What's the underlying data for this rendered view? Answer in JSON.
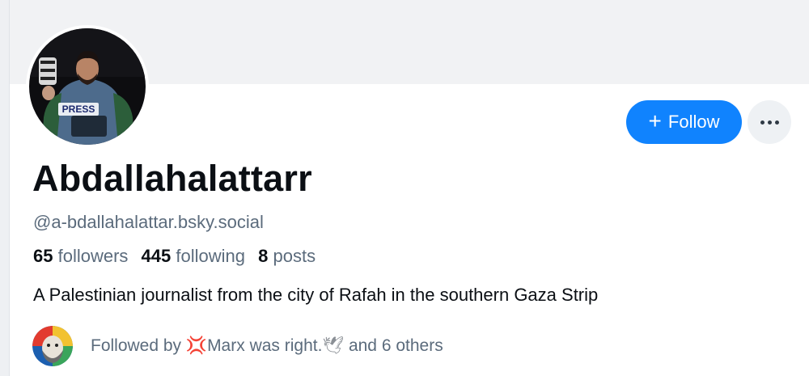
{
  "profile": {
    "display_name": "Abdallahalattarr",
    "handle": "@a-bdallahalattar.bsky.social",
    "bio": "A Palestinian journalist from the city of Rafah in the southern Gaza Strip",
    "avatar_badge_text": "PRESS"
  },
  "stats": {
    "followers_count": "65",
    "followers_label": "followers",
    "following_count": "445",
    "following_label": "following",
    "posts_count": "8",
    "posts_label": "posts"
  },
  "actions": {
    "follow_label": "Follow",
    "follow_icon": "plus-icon",
    "more_icon": "ellipsis-icon"
  },
  "followed_by": {
    "prefix": "Followed by",
    "emoji_1": "💢",
    "name": "Marx was right.",
    "emoji_2": "🕊",
    "suffix": "and 6 others"
  },
  "colors": {
    "accent": "#1083fe",
    "banner": "#f1f2f4",
    "muted_text": "#5b6b7c"
  }
}
